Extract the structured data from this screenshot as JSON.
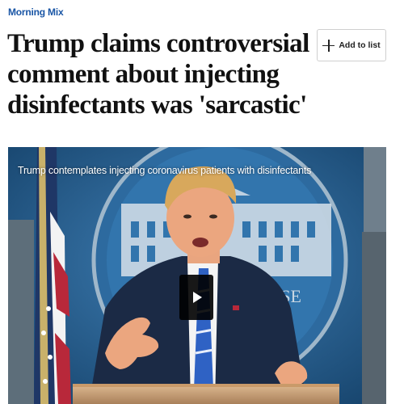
{
  "article": {
    "kicker": "Morning Mix",
    "headline_lines": [
      "Trump claims controversial",
      "comment about injecting",
      "disinfectants was 'sarcastic'"
    ]
  },
  "actions": {
    "add_to_list_label": "Add to list",
    "add_icon": "plus-icon"
  },
  "video": {
    "caption": "Trump contemplates injecting coronavirus patients with disinfectants",
    "play_icon": "play-icon",
    "podium_seal_text": "ISE"
  },
  "colors": {
    "kicker": "#1955a5",
    "headline": "#111111",
    "backdrop_blue": "#2a5f8e"
  }
}
